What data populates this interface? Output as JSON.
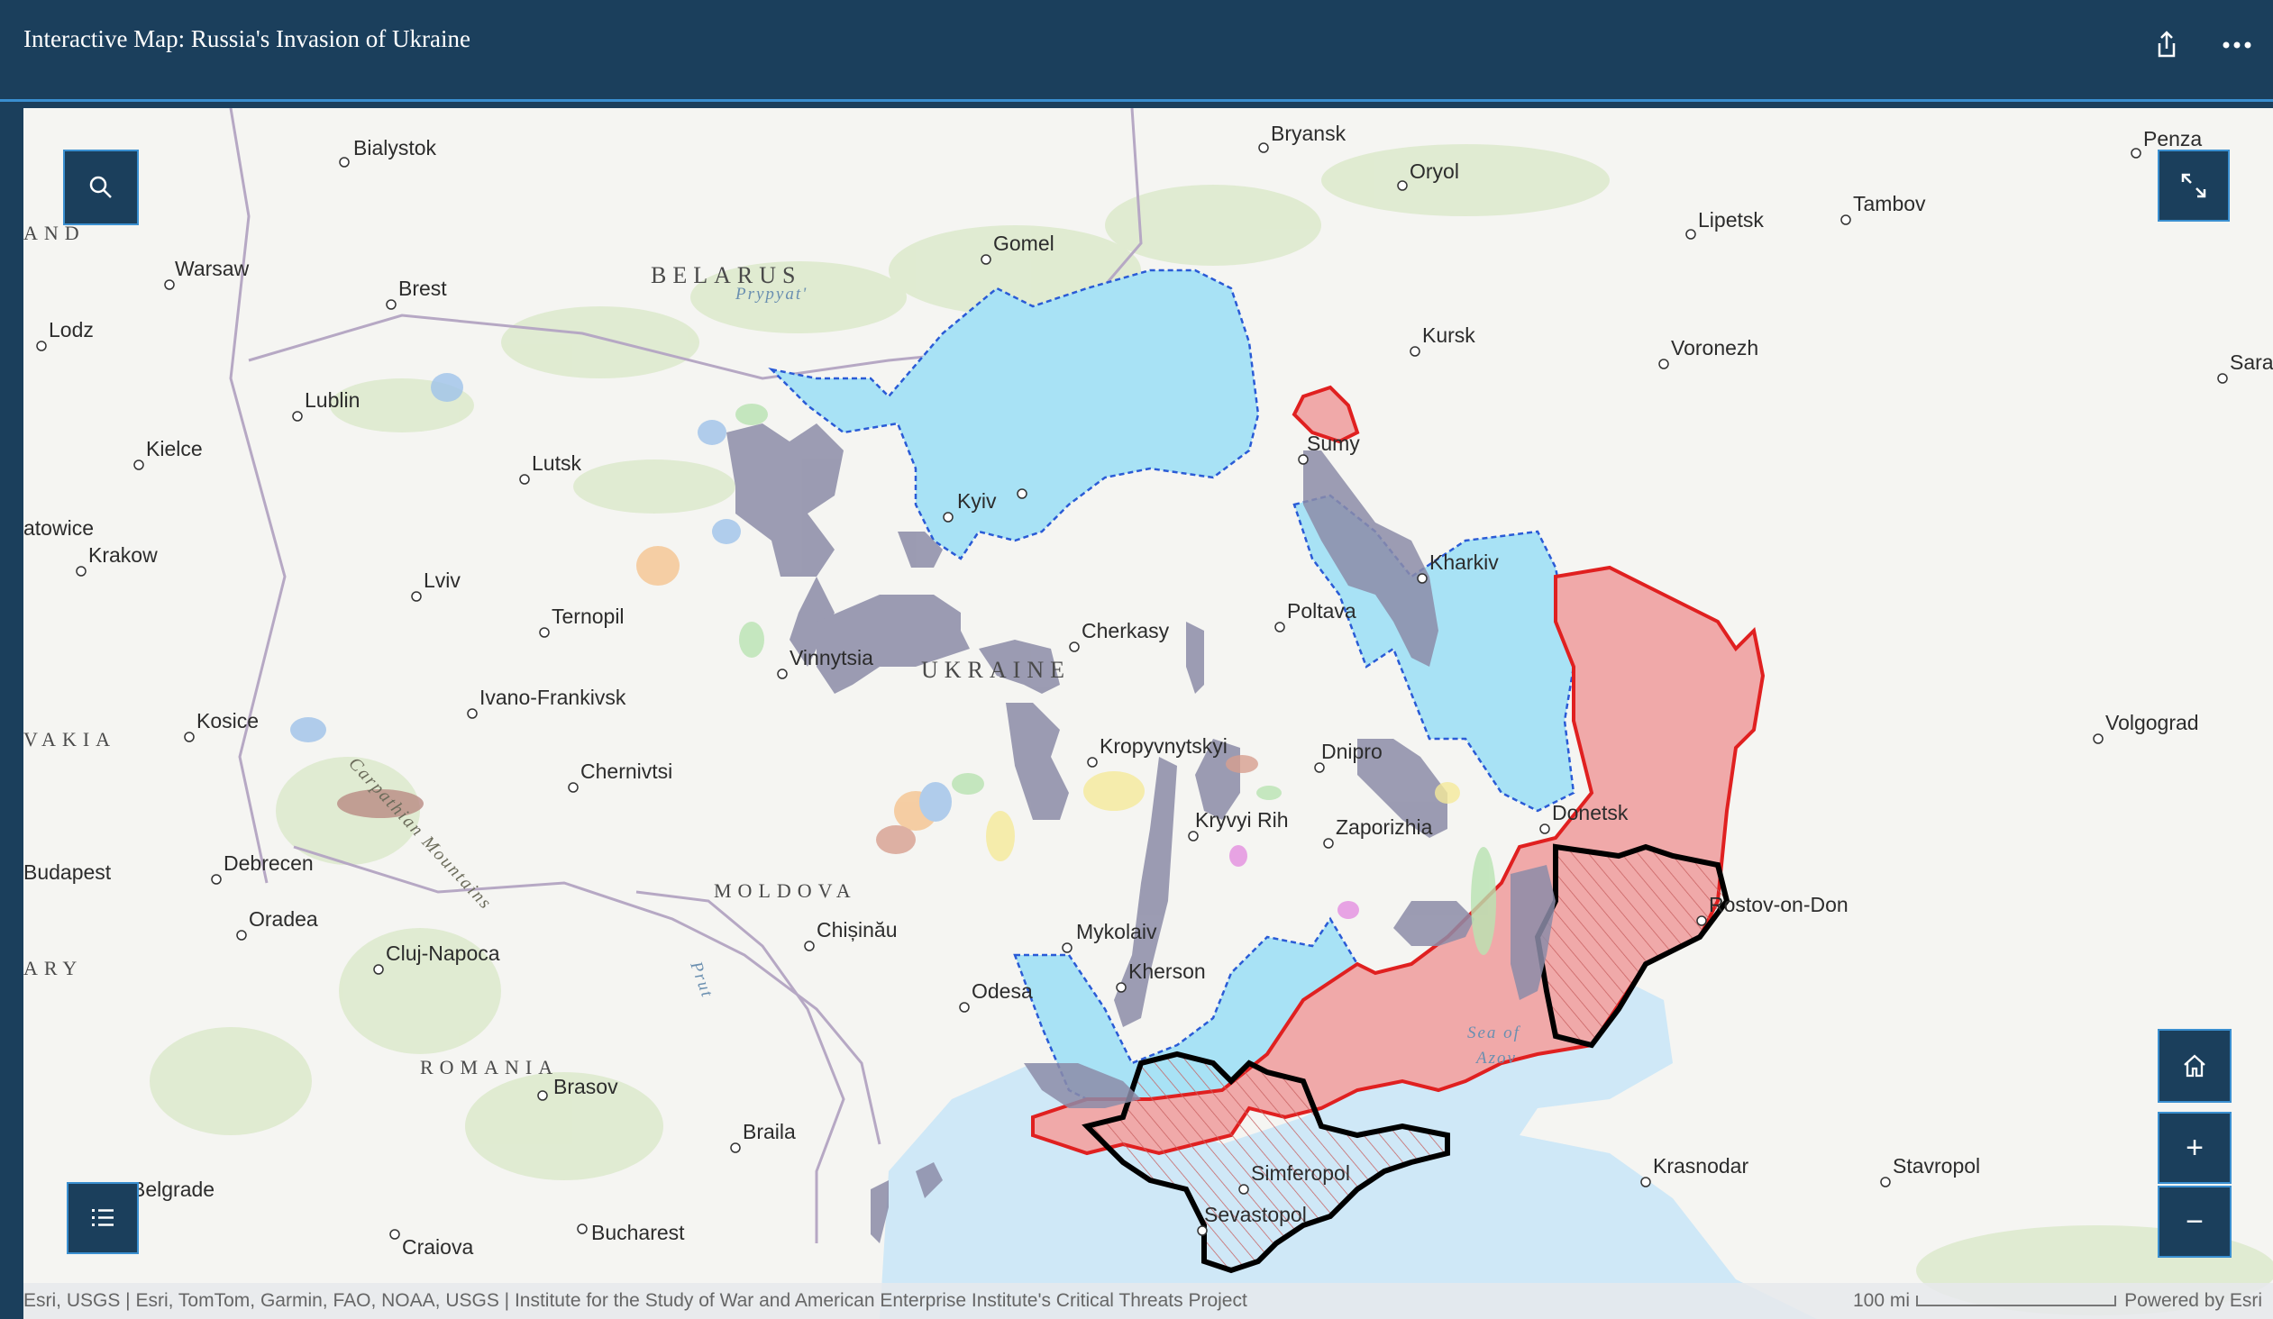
{
  "header": {
    "title": "Interactive Map: Russia's Invasion of Ukraine",
    "share_icon": "share-icon",
    "more_icon": "more-horizontal-icon"
  },
  "map": {
    "countries": [
      "BELARUS",
      "UKRAINE",
      "MOLDOVA",
      "ROMANIA",
      "AND",
      "VAKIA",
      "ARY"
    ],
    "cities": [
      "Bialystok",
      "Warsaw",
      "Brest",
      "Lodz",
      "Lublin",
      "Kielce",
      "Lutsk",
      "Gomel",
      "Bryansk",
      "Oryol",
      "Penza",
      "Lipetsk",
      "Tambov",
      "Kursk",
      "Voronezh",
      "Sarat",
      "Sumy",
      "Kyiv",
      "Kharkiv",
      "Poltava",
      "Cherkasy",
      "Vinnytsia",
      "Lviv",
      "Ternopil",
      "Ivano-Frankivsk",
      "Krakow",
      "atowice",
      "Kosice",
      "Chernivtsi",
      "Kropyvnytskyi",
      "Dnipro",
      "Kryvyi Rih",
      "Zaporizhia",
      "Donetsk",
      "Volgograd",
      "Rostov-on-Don",
      "Mykolaiv",
      "Kherson",
      "Odesa",
      "Chișinău",
      "Budapest",
      "Debrecen",
      "Oradea",
      "Cluj-Napoca",
      "Brasov",
      "Braila",
      "Belgrade",
      "Craiova",
      "Bucharest",
      "Simferopol",
      "Sevastopol",
      "Krasnodar",
      "Stavropol"
    ],
    "water_labels": [
      "Prypyat'",
      "Prut",
      "Sea of",
      "Azov"
    ],
    "mountain_label": "Carpathian Mountains",
    "colors": {
      "russian_control": "#f0a9a9",
      "russian_border": "#e02020",
      "ukraine_counteroffensive": "#a8e2f5",
      "assessed_advance": "#8c8ca8",
      "annexed_outline": "#000000"
    }
  },
  "controls": {
    "search_icon": "search-icon",
    "expand_icon": "expand-icon",
    "legend_icon": "list-icon",
    "home_icon": "home-icon",
    "zoom_in": "+",
    "zoom_out": "−"
  },
  "attribution": {
    "sources": "Esri, USGS | Esri, TomTom, Garmin, FAO, NOAA, USGS | Institute for the Study of War and American Enterprise Institute's Critical Threats Project",
    "scale": "100 mi",
    "powered": "Powered by Esri"
  }
}
